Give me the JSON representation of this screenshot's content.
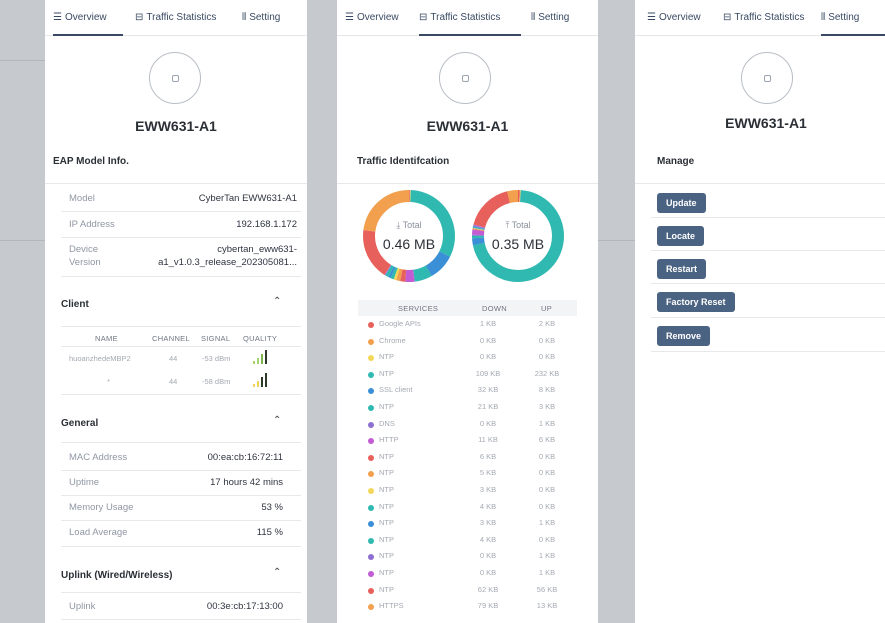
{
  "tabs": {
    "overview": "Overview",
    "traffic": "Traffic Statistics",
    "setting": "Setting"
  },
  "device_name": "EWW631-A1",
  "overview": {
    "model_section": "EAP Model Info.",
    "model_label": "Model",
    "model_value": "CyberTan EWW631-A1",
    "ip_label": "IP Address",
    "ip_value": "192.168.1.172",
    "device_version_label_1": "Device",
    "device_version_label_2": "Version",
    "device_version_value_1": "cybertan_eww631-",
    "device_version_value_2": "a1_v1.0.3_release_202305081...",
    "client_section": "Client",
    "client_headers": [
      "NAME",
      "CHANNEL",
      "SIGNAL",
      "QUALITY"
    ],
    "clients": [
      {
        "name": "huoanzhedeMBP2",
        "channel": "44",
        "signal": "-53 dBm"
      },
      {
        "name": "*",
        "channel": "44",
        "signal": "-58 dBm"
      }
    ],
    "general_section": "General",
    "mac_label": "MAC Address",
    "mac_value": "00:ea:cb:16:72:11",
    "uptime_label": "Uptime",
    "uptime_value": "17 hours 42 mins",
    "memory_label": "Memory Usage",
    "memory_value": "53 %",
    "load_label": "Load Average",
    "load_value": "115 %",
    "uplink_section": "Uplink (Wired/Wireless)",
    "uplink_label": "Uplink",
    "uplink_value": "00:3e:cb:17:13:00"
  },
  "traffic": {
    "section": "Traffic Identifcation",
    "down_label": "Total",
    "down_value": "0.46 MB",
    "up_label": "Total",
    "up_value": "0.35 MB",
    "headers": [
      "SERVICES",
      "DOWN",
      "UP"
    ],
    "services": [
      {
        "name": "Google APIs",
        "down": "1 KB",
        "up": "2 KB",
        "color": "#e8605b"
      },
      {
        "name": "Chrome",
        "down": "0 KB",
        "up": "0 KB",
        "color": "#f2a04d"
      },
      {
        "name": "NTP",
        "down": "0 KB",
        "up": "0 KB",
        "color": "#f3d75a"
      },
      {
        "name": "NTP",
        "down": "109 KB",
        "up": "232 KB",
        "color": "#2fb9b0"
      },
      {
        "name": "SSL client",
        "down": "32 KB",
        "up": "8 KB",
        "color": "#3a8fd6"
      },
      {
        "name": "NTP",
        "down": "21 KB",
        "up": "3 KB",
        "color": "#2fb9b0"
      },
      {
        "name": "DNS",
        "down": "0 KB",
        "up": "1 KB",
        "color": "#8d6fd1"
      },
      {
        "name": "HTTP",
        "down": "11 KB",
        "up": "6 KB",
        "color": "#c25bd4"
      },
      {
        "name": "NTP",
        "down": "6 KB",
        "up": "0 KB",
        "color": "#e8605b"
      },
      {
        "name": "NTP",
        "down": "5 KB",
        "up": "0 KB",
        "color": "#f2a04d"
      },
      {
        "name": "NTP",
        "down": "3 KB",
        "up": "0 KB",
        "color": "#f3d75a"
      },
      {
        "name": "NTP",
        "down": "4 KB",
        "up": "0 KB",
        "color": "#2fb9b0"
      },
      {
        "name": "NTP",
        "down": "3 KB",
        "up": "1 KB",
        "color": "#3a8fd6"
      },
      {
        "name": "NTP",
        "down": "4 KB",
        "up": "0 KB",
        "color": "#2fb9b0"
      },
      {
        "name": "NTP",
        "down": "0 KB",
        "up": "1 KB",
        "color": "#8d6fd1"
      },
      {
        "name": "NTP",
        "down": "0 KB",
        "up": "1 KB",
        "color": "#c25bd4"
      },
      {
        "name": "NTP",
        "down": "62 KB",
        "up": "56 KB",
        "color": "#e8605b"
      },
      {
        "name": "HTTPS",
        "down": "79 KB",
        "up": "13 KB",
        "color": "#f2a04d"
      }
    ]
  },
  "setting": {
    "section": "Manage",
    "buttons": [
      "Update",
      "Locate",
      "Restart",
      "Factory Reset",
      "Remove"
    ]
  },
  "colors": {
    "accent": "#3a4a63",
    "button": "#4b6383"
  }
}
